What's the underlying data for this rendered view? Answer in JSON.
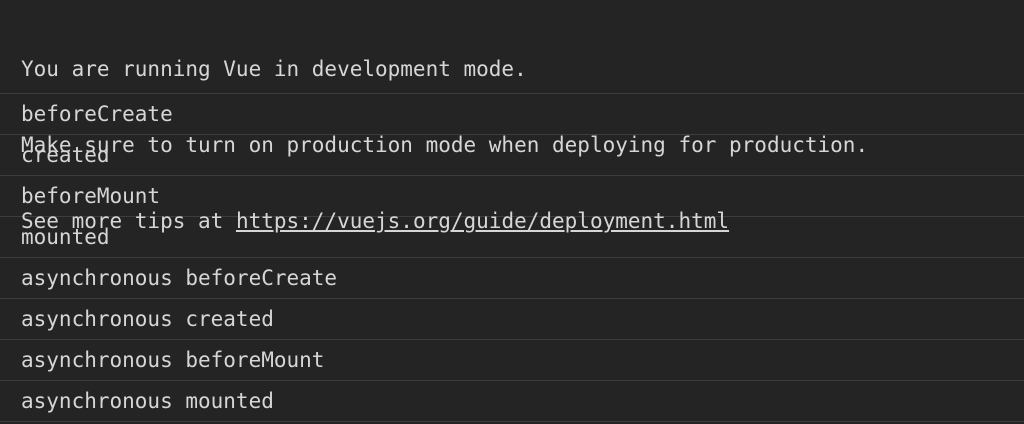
{
  "warning": {
    "line1": "You are running Vue in development mode.",
    "line2": "Make sure to turn on production mode when deploying for production.",
    "line3_prefix": "See more tips at ",
    "line3_link": "https://vuejs.org/guide/deployment.html"
  },
  "messages": [
    "beforeCreate",
    "created",
    "beforeMount",
    "mounted",
    "asynchronous beforeCreate",
    "asynchronous created",
    "asynchronous beforeMount",
    "asynchronous mounted"
  ],
  "colors": {
    "background": "#242424",
    "text": "#d6d6d6",
    "divider": "#3d3d3d"
  }
}
